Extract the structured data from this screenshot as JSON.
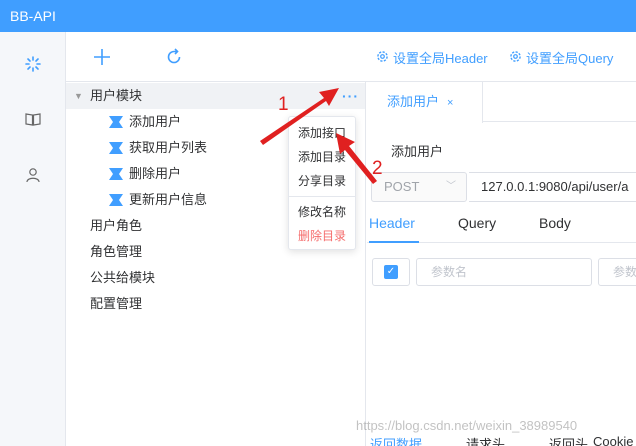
{
  "app": {
    "title": "BB-API"
  },
  "leftnav": {
    "icons": [
      "spinner-icon",
      "book-icon",
      "user-icon"
    ]
  },
  "toolbar": {
    "add_icon": "plus-icon",
    "refresh_icon": "refresh-icon",
    "global_header": "设置全局Header",
    "global_query": "设置全局Query"
  },
  "tree": {
    "module": "用户模块",
    "children": [
      "添加用户",
      "获取用户列表",
      "删除用户",
      "更新用户信息"
    ],
    "others": [
      "用户角色",
      "角色管理",
      "公共给模块",
      "配置管理"
    ],
    "more": "···"
  },
  "context_menu": {
    "items": [
      "添加接口",
      "添加目录",
      "分享目录"
    ],
    "rename": "修改名称",
    "delete": "删除目录"
  },
  "annotations": {
    "one": "1",
    "two": "2"
  },
  "main": {
    "tab_label": "添加用户",
    "tab_close": "×",
    "api_name": "添加用户",
    "method": "POST",
    "url": "127.0.0.1:9080/api/user/a",
    "subtabs": [
      "Header",
      "Query",
      "Body"
    ],
    "param_name_placeholder": "参数名",
    "param_value_placeholder": "参数",
    "bottom_tabs": [
      "返回数据",
      "请求头",
      "返回头",
      "Cookie"
    ]
  },
  "watermark": "https://blog.csdn.net/weixin_38989540",
  "colors": {
    "accent": "#409eff",
    "danger": "#f56c6c",
    "annotation": "#e02020"
  }
}
